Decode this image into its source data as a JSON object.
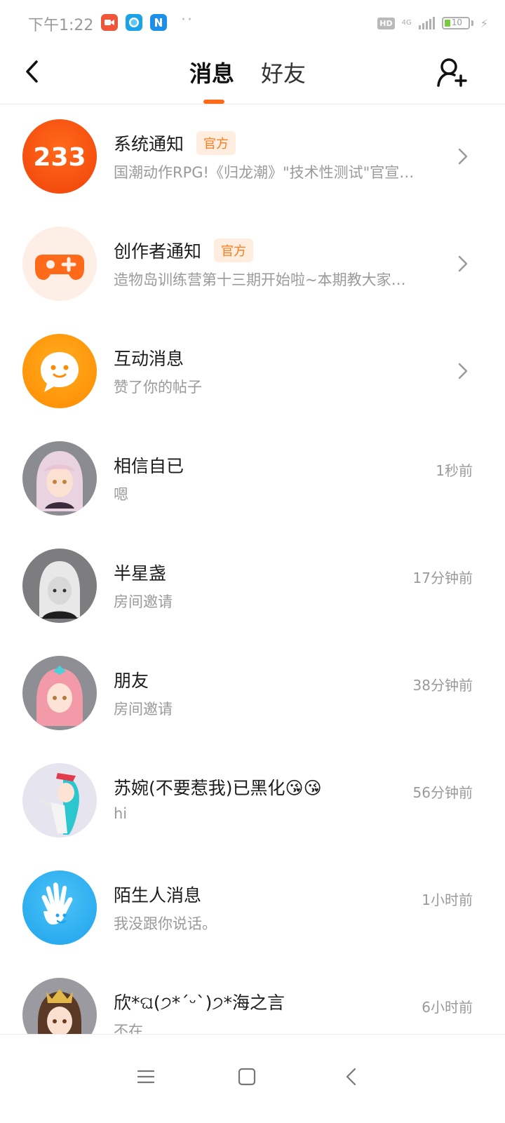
{
  "status_bar": {
    "time": "下午1:22",
    "hd": "HD",
    "network": "4G",
    "battery": "10",
    "battery_level": 0.1
  },
  "header": {
    "tabs": [
      {
        "label": "消息",
        "active": true
      },
      {
        "label": "好友",
        "active": false
      }
    ],
    "accent_color": "#ff6a1a"
  },
  "messages": [
    {
      "name": "系统通知",
      "badge": "官方",
      "preview": "国潮动作RPG!《归龙潮》\"技术性测试\"官宣…",
      "time": "",
      "avatar": "233-logo-icon",
      "avatar_text": "233"
    },
    {
      "name": "创作者通知",
      "badge": "官方",
      "preview": "造物岛训练营第十三期开始啦~本期教大家…",
      "time": "",
      "avatar": "gamepad-icon"
    },
    {
      "name": "互动消息",
      "badge": "",
      "preview": "赞了你的帖子",
      "time": "",
      "avatar": "chat-bubble-icon"
    },
    {
      "name": "相信自已",
      "badge": "",
      "preview": "嗯",
      "time": "1秒前",
      "avatar": "avatar-pink-hair"
    },
    {
      "name": "半星盏",
      "badge": "",
      "preview": "房间邀请",
      "time": "17分钟前",
      "avatar": "avatar-white-hair"
    },
    {
      "name": "朋友",
      "badge": "",
      "preview": "房间邀请",
      "time": "38分钟前",
      "avatar": "avatar-pink-braids"
    },
    {
      "name": "苏婉(不要惹我)已黑化😘😘",
      "badge": "",
      "preview": "hi",
      "time": "56分钟前",
      "avatar": "avatar-teal-hair"
    },
    {
      "name": "陌生人消息",
      "badge": "",
      "preview": "我没跟你说话。",
      "time": "1小时前",
      "avatar": "hand-wave-icon"
    },
    {
      "name": "欣*ଘ(੭*ˊᵕˋ)੭*海之言",
      "badge": "",
      "preview": "不在",
      "time": "6小时前",
      "avatar": "avatar-crown-hair"
    }
  ],
  "nav_bar": {
    "icons": [
      "menu-icon",
      "home-square-icon",
      "back-triangle-icon"
    ]
  }
}
